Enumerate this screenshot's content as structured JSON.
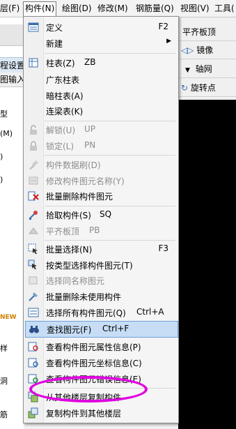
{
  "menubar": {
    "items": [
      "层(F)",
      "构件(N)",
      "绘图(D)",
      "修改(M)",
      "钢筋量(Q)",
      "视图(V)",
      "工具("
    ],
    "active_index": 1
  },
  "left_pane": {
    "tab_label": "程设置",
    "subtab_label": "图输入",
    "fragments": [
      "型",
      "(M)",
      ")",
      ")",
      "样",
      "洞",
      "筋"
    ],
    "new_badge": "NEW"
  },
  "right_pane": {
    "row1": "平齐板顶",
    "row2": "镜像",
    "row3": "轴网",
    "row4": "旋转点"
  },
  "menu": {
    "items": [
      {
        "label": "定义",
        "shortcut": "F2",
        "icon": "define-icon"
      },
      {
        "label": "新建",
        "submenu": true
      },
      {
        "label": "柱表(Z)",
        "shortcut": "ZB",
        "icon": "column-table-icon"
      },
      {
        "label": "广东柱表"
      },
      {
        "label": "暗柱表(A)"
      },
      {
        "label": "连梁表(K)"
      },
      {
        "label": "解锁(U)",
        "shortcut": "UP",
        "disabled": true,
        "icon": "unlock-icon"
      },
      {
        "label": "锁定(L)",
        "shortcut": "PN",
        "disabled": true,
        "icon": "lock-icon"
      },
      {
        "label": "构件数据刷(D)",
        "disabled": true,
        "icon": "brush-icon"
      },
      {
        "label": "修改构件图元名称(Y)",
        "disabled": true,
        "icon": "rename-icon"
      },
      {
        "label": "批量删除构件图元",
        "icon": "batch-delete-icon"
      },
      {
        "label": "拾取构件(S)",
        "shortcut": "SQ",
        "icon": "eyedropper-icon"
      },
      {
        "label": "平齐板顶",
        "shortcut": "PB",
        "disabled": true,
        "icon": "align-top-icon"
      },
      {
        "label": "批量选择(N)",
        "shortcut": "F3",
        "icon": "batch-select-icon"
      },
      {
        "label": "按类型选择构件图元(T)",
        "icon": "select-by-type-icon"
      },
      {
        "label": "选择同名称图元",
        "disabled": true,
        "icon": "select-same-name-icon"
      },
      {
        "label": "批量删除未使用构件",
        "icon": "delete-unused-icon"
      },
      {
        "label": "选择所有构件图元(Q)",
        "shortcut": "Ctrl+A",
        "icon": "select-all-icon"
      },
      {
        "label": "查找图元(F)",
        "shortcut": "Ctrl+F",
        "icon": "binoculars-icon",
        "highlighted": true
      },
      {
        "label": "查看构件图元属性信息(P)",
        "icon": "view-properties-icon"
      },
      {
        "label": "查看构件图元坐标信息(C)",
        "icon": "view-coords-icon"
      },
      {
        "label": "查看构件图元错误信息(E)",
        "icon": "view-errors-icon"
      },
      {
        "label": "从其他楼层复制构件",
        "icon": "copy-from-floor-icon"
      },
      {
        "label": "复制构件到其他楼层",
        "icon": "copy-to-floor-icon"
      }
    ]
  },
  "colors": {
    "highlight": "#c6ddf5",
    "highlight_border": "#6f9fd8",
    "annotation": "#e000e0",
    "disabled_text": "#8d8d8d"
  }
}
